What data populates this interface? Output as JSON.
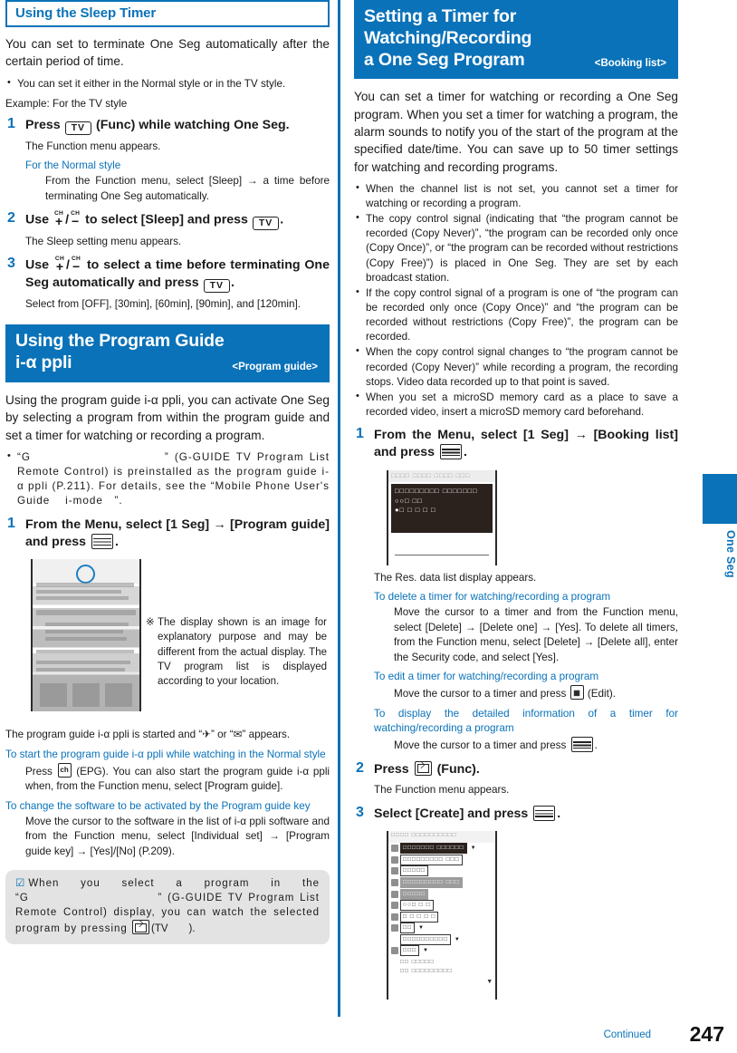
{
  "page": {
    "number": "247",
    "continued_label": "Continued"
  },
  "side_tab": {
    "label": "One Seg",
    "color": "#0a72b9"
  },
  "left_column": {
    "section1": {
      "heading": "Using the Sleep Timer",
      "intro": "You can set to terminate One Seg automatically after the certain period of time.",
      "bullets": [
        "You can set it either in the Normal style or in the TV style."
      ],
      "example_label": "Example: For the TV style",
      "steps": [
        {
          "num": "1",
          "text_a": "Press",
          "key": "TV",
          "text_b": "(Func) while watching One Seg.",
          "result": "The Function menu appears.",
          "blue_sub": "For the Normal style",
          "blue_body": "From the Function menu, select [Sleep] → a time before terminating One Seg automatically."
        },
        {
          "num": "2",
          "text_a": "Use",
          "ch_plus": "+",
          "ch_minus": "−",
          "ch_label": "CH",
          "text_b": "to select [Sleep] and press",
          "key": "TV",
          "text_c": ".",
          "result": "The Sleep setting menu appears."
        },
        {
          "num": "3",
          "text_a": "Use",
          "text_b": "to select a time before terminating One Seg automatically and press",
          "key": "TV",
          "text_c": ".",
          "result": "Select from [OFF], [30min], [60min], [90min], and [120min]."
        }
      ]
    },
    "section2": {
      "heading_line1": "Using the Program Guide",
      "heading_line2": "i-α ppli",
      "tag": "<Program guide>",
      "intro": "Using the program guide i-α ppli, you can activate One Seg by selecting a program from within the program guide and set a timer for watching or recording a program.",
      "bullets": [
        "“G　　　　　　　　　　” (G-GUIDE TV Program List Remote Control) is preinstalled as the program guide i-α ppli (P.211). For details, see the “Mobile Phone User's Guide　 i-mode　”."
      ],
      "step1": {
        "num": "1",
        "text": "From the Menu, select [1 Seg] → [Program guide] and press",
        "key": "menu-key"
      },
      "side_note_marker": "※",
      "side_note": "The display shown is an image for explanatory purpose and may be different from the actual display. The TV program list is displayed according to your location.",
      "after_shot": "The program guide i-α ppli is started and “✈” or “✉” appears.",
      "sub1_heading": "To start the program guide i-α ppli while watching in the Normal style",
      "sub1_body_a": "Press",
      "sub1_key": "ch",
      "sub1_body_b": "(EPG). You can also start the program guide i-α ppli when, from the Function menu, select [Program guide].",
      "sub2_heading": "To change the software to be activated by the Program guide key",
      "sub2_body": "Move the cursor to the software in the list of i-α ppli software and from the Function menu, select [Individual set] → [Program guide key] → [Yes]/[No] (P.209).",
      "note_marker": "☑",
      "note": "When you select a program in the “G　　　　　　　　　　” (G-GUIDE TV Program List Remote Control) display, you can watch the selected program by pressing",
      "note_tail": "(TV　　)."
    }
  },
  "right_column": {
    "heading_line1": "Setting a Timer for Watching/Recording",
    "heading_line2": "a One Seg Program",
    "tag": "<Booking list>",
    "intro": "You can set a timer for watching or recording a One Seg program. When you set a timer for watching a program, the alarm sounds to notify you of the start of the program at the specified date/time. You can save up to 50 timer settings for watching and recording programs.",
    "bullets": [
      "When the channel list is not set, you cannot set a timer for watching or recording a program.",
      "The copy control signal (indicating that “the program cannot be recorded (Copy Never)”, “the program can be recorded only once (Copy Once)”, or “the program can be recorded without restrictions (Copy Free)”) is placed in One Seg. They are set by each broadcast station.",
      "If the copy control signal of a program is one of “the program can be recorded only once (Copy Once)” and “the program can be recorded without restrictions (Copy Free)”, the program can be recorded.",
      "When the copy control signal changes to “the program cannot be recorded (Copy Never)” while recording a program, the recording stops. Video data recorded up to that point is saved.",
      "When you set a microSD memory card as a place to save a recorded video, insert a microSD memory card beforehand."
    ],
    "steps": [
      {
        "num": "1",
        "text": "From the Menu, select [1 Seg] → [Booking list] and press",
        "key": "menu-key",
        "result": "The Res. data list display appears.",
        "subs": [
          {
            "heading": "To delete a timer for watching/recording a program",
            "body": "Move the cursor to a timer and from the Function menu, select [Delete] → [Delete one] → [Yes]. To delete all timers, from the Function menu, select [Delete] → [Delete all], enter the Security code, and select [Yes]."
          },
          {
            "heading": "To edit a timer for watching/recording a program",
            "body_a": "Move the cursor to a timer and press",
            "key": "edit-key",
            "body_b": "(Edit)."
          },
          {
            "heading": "To display the detailed information of a timer for watching/recording a program",
            "body_a": "Move the cursor to a timer and press",
            "key": "menu-key",
            "body_b": "."
          }
        ]
      },
      {
        "num": "2",
        "text_a": "Press",
        "key": "mail-key",
        "text_b": "(Func).",
        "result": "The Function menu appears."
      },
      {
        "num": "3",
        "text": "Select [Create] and press",
        "key": "menu-key"
      }
    ]
  },
  "device_shots": {
    "booking_list": {
      "status_bar": "□□□□ □□□□ □□□□  □□□",
      "panel_line1": "□□□□□□□□□ □□□□□□□",
      "panel_line2": "○○□ □□",
      "panel_line3": "●□ □ □ □ □"
    },
    "create_form": {
      "title": "□□□□ □□□□□□□□□□",
      "rows": [
        {
          "value": "□□□□□□□ □□□□□□",
          "style": "dark",
          "caret": true
        },
        {
          "value": "□□□□□□□□□ □□□",
          "style": "light",
          "caret": false
        },
        {
          "value": "□□□□□",
          "style": "light",
          "caret": false
        },
        {
          "value": "□□□□□□□□□ □□□",
          "style": "gray",
          "caret": false
        },
        {
          "value": "□□□□□",
          "style": "gray",
          "caret": false
        },
        {
          "value": "○○□ □ □",
          "style": "light",
          "caret": false
        },
        {
          "value": "□ □ □ □ □",
          "style": "light",
          "caret": false
        },
        {
          "value": "□□",
          "style": "light",
          "caret": true
        },
        {
          "value": "□□□□□□□□□□",
          "style": "light",
          "caret": true
        },
        {
          "value": "□□□",
          "style": "light",
          "caret": true
        }
      ],
      "footer_line1": "□□ □□□□□",
      "footer_line2": "□□  □□□□□□□□□"
    }
  }
}
